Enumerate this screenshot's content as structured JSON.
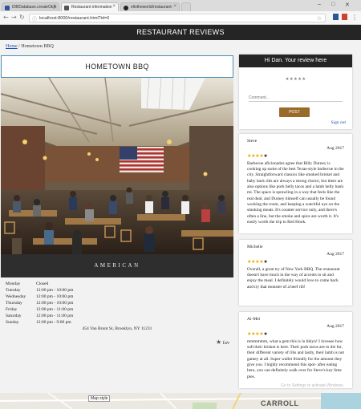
{
  "browser": {
    "tabs": [
      {
        "label": "IDBDatabase.createObje",
        "favicon_color": "#2b5797"
      },
      {
        "label": "Restaurant information",
        "favicon_color": "#555555"
      },
      {
        "label": "ellotheworld/restaurant-"
      }
    ],
    "url": "localhost:8000/restaurant.html?id=6"
  },
  "header": {
    "title": "RESTAURANT REVIEWS"
  },
  "breadcrumb": {
    "home": "Home",
    "current": "/ Hometown BBQ"
  },
  "restaurant": {
    "name": "HOMETOWN BBQ",
    "cuisine": "AMERICAN",
    "address": "454 Van Brunt St, Brooklyn, NY 11231",
    "fav_label": "fav",
    "hours": [
      {
        "day": "Monday",
        "time": "Closed"
      },
      {
        "day": "Tuesday",
        "time": "12:00 pm - 10:00 pm"
      },
      {
        "day": "Wednesday",
        "time": "12:00 pm - 10:00 pm"
      },
      {
        "day": "Thursday",
        "time": "12:00 pm - 10:00 pm"
      },
      {
        "day": "Friday",
        "time": "12:00 pm - 11:00 pm"
      },
      {
        "day": "Saturday",
        "time": "12:00 pm - 11:00 pm"
      },
      {
        "day": "Sunday",
        "time": "12:00 pm - 9:00 pm"
      }
    ]
  },
  "review_form": {
    "heading": "Hi Dan. Your review here",
    "stars": "★★★★★",
    "comment_placeholder": "Comment...",
    "post_label": "POST",
    "signout_label": "Sign out"
  },
  "reviews": [
    {
      "name": "Steve",
      "date": "Aug 2017",
      "rating": 4,
      "text": "Barbecue aficionados agree that Billy Durney is cooking up some of the best Texas-style barbecue in the city. Straightforward classics like smoked brisket and baby back ribs are always a strong choice, but there are also options like pork belly tacos and a lamb belly banh mi. The space is sprawling in a way that feels like the real deal, and Durney himself can usually be found working the room, and keeping a watchful eye on the smoking meats. It's counter service only, and there's often a line, but the smoke and spice are worth it. It's easily worth the trip to Red Hook."
    },
    {
      "name": "Michelle",
      "date": "Aug 2017",
      "rating": 4,
      "text": "Overall, a great try of New York BBQ. The restaurant doesn't have much in the way of accents to sit and enjoy the meal. I definitely would love to come back and try that monster of a beef rib!"
    },
    {
      "name": "Ai-Mei",
      "date": "Aug 2017",
      "rating": 4,
      "text": "mmmmmm, what a gem this is in bklyn! I loveeee how soft their brisket is here. Their pork tacos are to die for, their different variety of ribs and lastly, their lamb is not gamey at all. Super wallet friendly for the amount they give you. I highly recommend this spot- after eating here, you can definitely walk over for Steve's key lime pies."
    }
  ],
  "map": {
    "style_button": "Map style",
    "label": "CARROLL"
  },
  "watermark": "Go to Settings to activate Windows."
}
